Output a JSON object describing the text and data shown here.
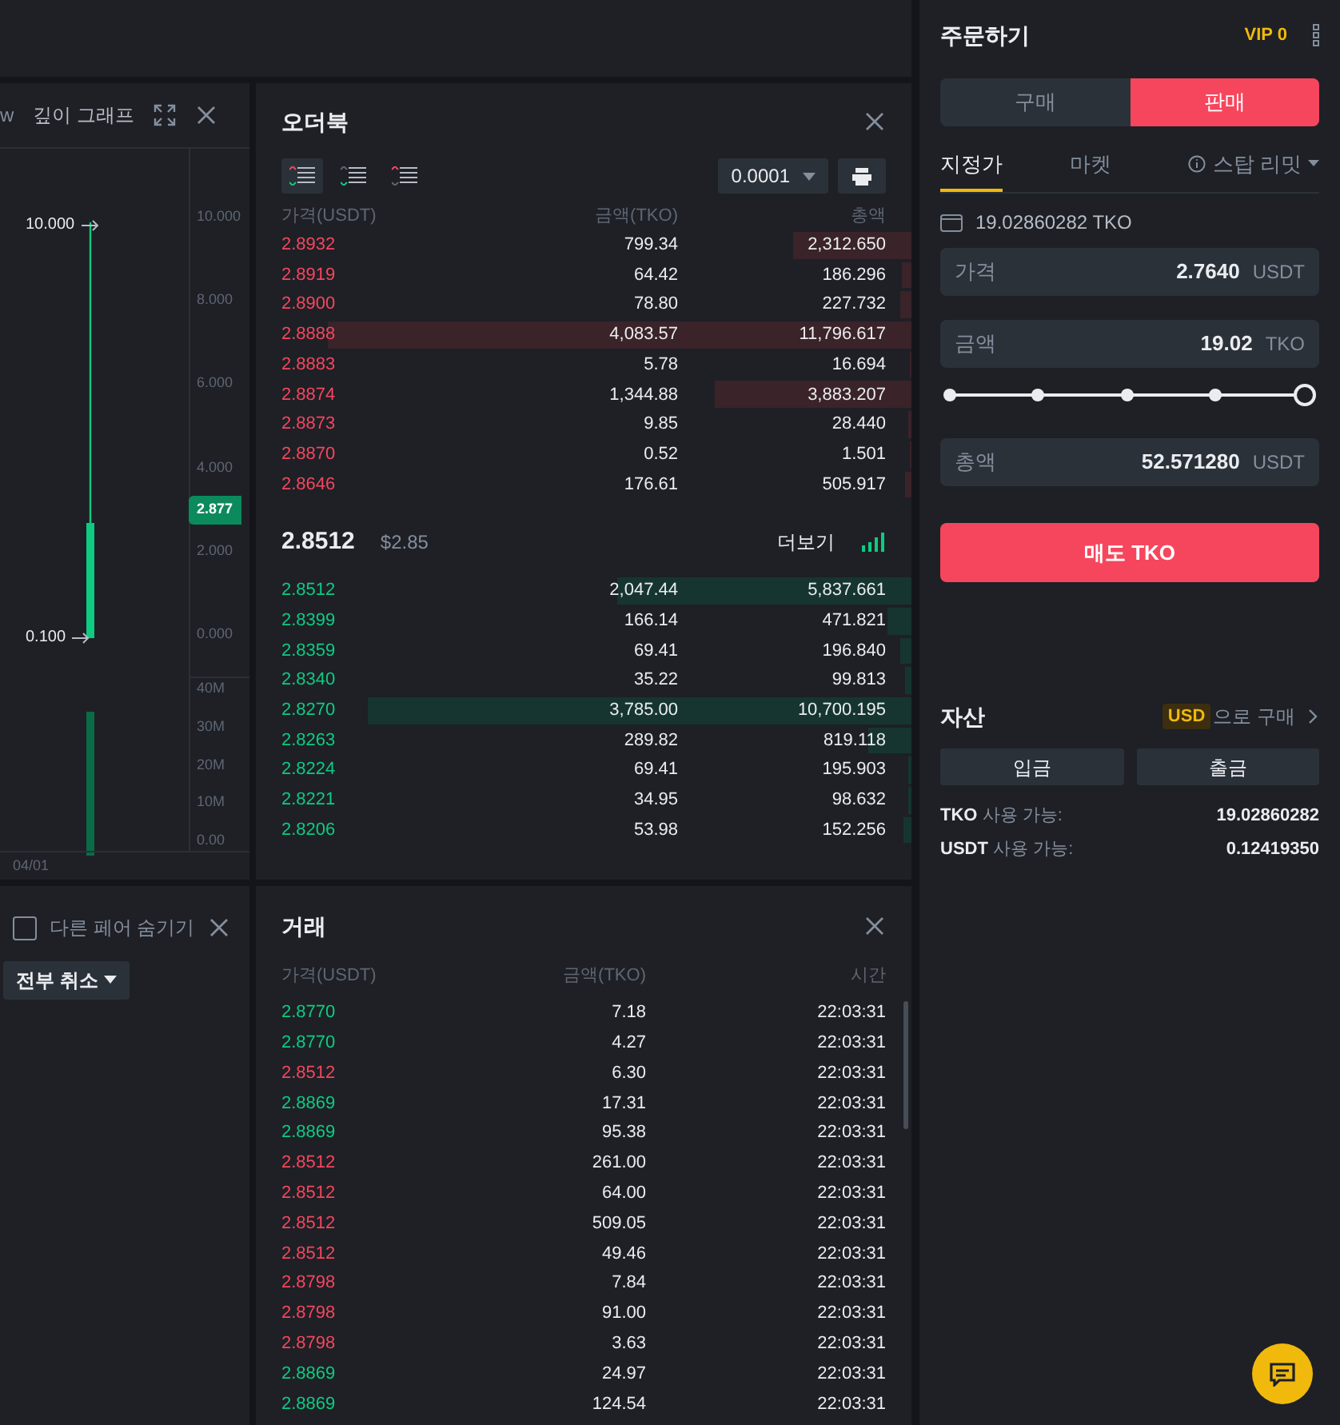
{
  "chart_panel": {
    "tab_partial": "w",
    "title": "깊이 그래프",
    "price_ticks": [
      "10.000",
      "8.000",
      "6.000",
      "4.000",
      "2.000",
      "0.000"
    ],
    "volume_ticks": [
      "40M",
      "30M",
      "20M",
      "10M",
      "0.00"
    ],
    "high_label": "10.000",
    "low_label": "0.100",
    "last_price": "2.877",
    "date_label": "04/01"
  },
  "open_orders": {
    "hide_other_pairs": {
      "label": "다른 페어 숨기기",
      "checked": false
    },
    "cancel_all": "전부 취소"
  },
  "order_book": {
    "title": "오더북",
    "views": [
      {
        "selected": true
      },
      {
        "selected": false
      },
      {
        "selected": false
      }
    ],
    "precision": "0.0001",
    "columns": [
      "가격(USDT)",
      "금액(TKO)",
      "총액"
    ],
    "asks": [
      {
        "price": "2.8932",
        "amount": "799.34",
        "total": "2,312.650",
        "level": 0.18
      },
      {
        "price": "2.8919",
        "amount": "64.42",
        "total": "186.296",
        "level": 0.015
      },
      {
        "price": "2.8900",
        "amount": "78.80",
        "total": "227.732",
        "level": 0.017
      },
      {
        "price": "2.8888",
        "amount": "4,083.57",
        "total": "11,796.617",
        "level": 0.89
      },
      {
        "price": "2.8883",
        "amount": "5.78",
        "total": "16.694",
        "level": 0.003
      },
      {
        "price": "2.8874",
        "amount": "1,344.88",
        "total": "3,883.207",
        "level": 0.3
      },
      {
        "price": "2.8873",
        "amount": "9.85",
        "total": "28.440",
        "level": 0.005
      },
      {
        "price": "2.8870",
        "amount": "0.52",
        "total": "1.501",
        "level": 0.002
      },
      {
        "price": "2.8646",
        "amount": "176.61",
        "total": "505.917",
        "level": 0.01
      }
    ],
    "last_price": "2.8512",
    "last_price_usd": "$2.85",
    "more": "더보기",
    "bids": [
      {
        "price": "2.8512",
        "amount": "2,047.44",
        "total": "5,837.661",
        "level": 0.45
      },
      {
        "price": "2.8399",
        "amount": "166.14",
        "total": "471.821",
        "level": 0.037
      },
      {
        "price": "2.8359",
        "amount": "69.41",
        "total": "196.840",
        "level": 0.017
      },
      {
        "price": "2.8340",
        "amount": "35.22",
        "total": "99.813",
        "level": 0.01
      },
      {
        "price": "2.8270",
        "amount": "3,785.00",
        "total": "10,700.195",
        "level": 0.83
      },
      {
        "price": "2.8263",
        "amount": "289.82",
        "total": "819.118",
        "level": 0.066
      },
      {
        "price": "2.8224",
        "amount": "69.41",
        "total": "195.903",
        "level": 0.005
      },
      {
        "price": "2.8221",
        "amount": "34.95",
        "total": "98.632",
        "level": 0.005
      },
      {
        "price": "2.8206",
        "amount": "53.98",
        "total": "152.256",
        "level": 0.012
      }
    ]
  },
  "trades": {
    "title": "거래",
    "columns": [
      "가격(USDT)",
      "금액(TKO)",
      "시간"
    ],
    "rows": [
      {
        "color": "#0ecb81",
        "price": "2.8770",
        "amount": "7.18",
        "time": "22:03:31"
      },
      {
        "color": "#0ecb81",
        "price": "2.8770",
        "amount": "4.27",
        "time": "22:03:31"
      },
      {
        "color": "#f6465d",
        "price": "2.8512",
        "amount": "6.30",
        "time": "22:03:31"
      },
      {
        "color": "#0ecb81",
        "price": "2.8869",
        "amount": "17.31",
        "time": "22:03:31"
      },
      {
        "color": "#0ecb81",
        "price": "2.8869",
        "amount": "95.38",
        "time": "22:03:31"
      },
      {
        "color": "#f6465d",
        "price": "2.8512",
        "amount": "261.00",
        "time": "22:03:31"
      },
      {
        "color": "#f6465d",
        "price": "2.8512",
        "amount": "64.00",
        "time": "22:03:31"
      },
      {
        "color": "#f6465d",
        "price": "2.8512",
        "amount": "509.05",
        "time": "22:03:31"
      },
      {
        "color": "#f6465d",
        "price": "2.8512",
        "amount": "49.46",
        "time": "22:03:31"
      },
      {
        "color": "#f6465d",
        "price": "2.8798",
        "amount": "7.84",
        "time": "22:03:31"
      },
      {
        "color": "#f6465d",
        "price": "2.8798",
        "amount": "91.00",
        "time": "22:03:31"
      },
      {
        "color": "#f6465d",
        "price": "2.8798",
        "amount": "3.63",
        "time": "22:03:31"
      },
      {
        "color": "#0ecb81",
        "price": "2.8869",
        "amount": "24.97",
        "time": "22:03:31"
      },
      {
        "color": "#0ecb81",
        "price": "2.8869",
        "amount": "124.54",
        "time": "22:03:31"
      }
    ]
  },
  "order_form": {
    "title": "주문하기",
    "vip": "VIP 0",
    "sides": [
      {
        "label": "구매",
        "selected": false
      },
      {
        "label": "판매",
        "selected": true
      }
    ],
    "order_types": [
      {
        "label": "지정가",
        "selected": true
      },
      {
        "label": "마켓",
        "selected": false
      },
      {
        "label": "스탑 리밋",
        "selected": false
      }
    ],
    "balance": "19.02860282 TKO",
    "fields": [
      {
        "label": "가격",
        "value": "2.7640",
        "unit": "USDT"
      },
      {
        "label": "금액",
        "value": "19.02",
        "unit": "TKO"
      }
    ],
    "slider": {
      "level": 1.0
    },
    "total": {
      "label": "총액",
      "value": "52.571280",
      "unit": "USDT"
    },
    "submit": "매도 TKO"
  },
  "assets": {
    "title": "자산",
    "currency_badge": "USD",
    "buy_link": "으로 구매",
    "buttons": [
      "입금",
      "출금"
    ],
    "balances": [
      {
        "asset": "TKO",
        "label": "사용 가능:",
        "value": "19.02860282"
      },
      {
        "asset": "USDT",
        "label": "사용 가능:",
        "value": "0.12419350"
      }
    ]
  }
}
